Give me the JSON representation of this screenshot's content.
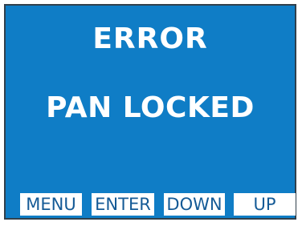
{
  "display": {
    "title": "ERROR",
    "message": "PAN LOCKED"
  },
  "softkeys": {
    "menu_label": "MENU",
    "enter_label": "ENTER",
    "down_label": "DOWN",
    "up_label": "UP"
  },
  "colors": {
    "screen_background": "#0f7dc6",
    "screen_border": "#30404c",
    "text_primary": "#ffffff",
    "softkey_background": "#ffffff",
    "softkey_text": "#145a96"
  }
}
